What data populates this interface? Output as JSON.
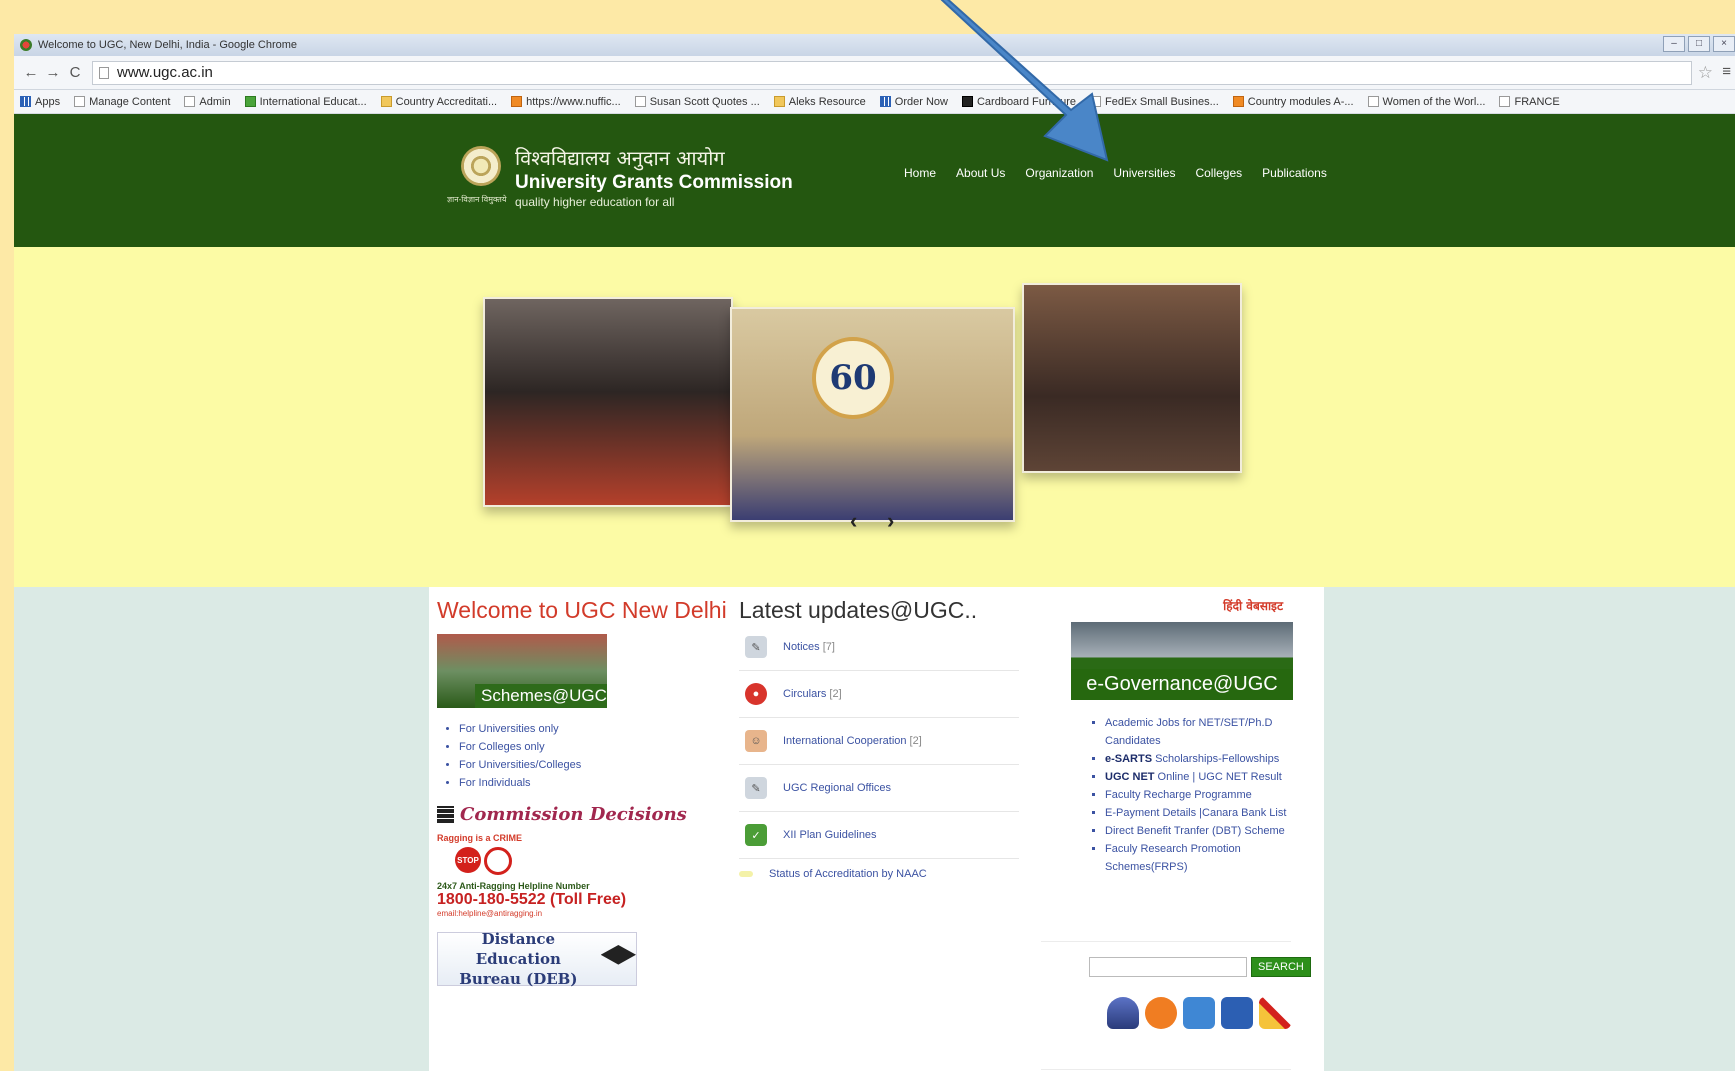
{
  "browser": {
    "window_title": "Welcome to UGC, New Delhi, India - Google Chrome",
    "url": "www.ugc.ac.in",
    "bookmarks": [
      {
        "label": "Apps",
        "icon": "apps-grid-icon"
      },
      {
        "label": "Manage Content",
        "icon": "page-icon"
      },
      {
        "label": "Admin",
        "icon": "page-icon"
      },
      {
        "label": "International Educat...",
        "icon": "plant-icon"
      },
      {
        "label": "Country Accreditati...",
        "icon": "folder-icon"
      },
      {
        "label": "https://www.nuffic...",
        "icon": "orange-icon"
      },
      {
        "label": "Susan Scott Quotes ...",
        "icon": "page-icon"
      },
      {
        "label": "Aleks Resource",
        "icon": "folder-icon"
      },
      {
        "label": "Order Now",
        "icon": "grid-icon"
      },
      {
        "label": "Cardboard Furniture",
        "icon": "black-icon"
      },
      {
        "label": "FedEx Small Busines...",
        "icon": "page-icon"
      },
      {
        "label": "Country modules A-...",
        "icon": "orange-icon"
      },
      {
        "label": "Women of the Worl...",
        "icon": "page-icon"
      },
      {
        "label": "FRANCE",
        "icon": "page-icon"
      }
    ]
  },
  "header": {
    "hindi_title": "विश्वविद्यालय अनुदान आयोग",
    "english_title": "University Grants Commission",
    "tagline": "quality higher education for all",
    "emblem_caption": "ज्ञान-विज्ञान विमुक्तये",
    "nav": [
      "Home",
      "About Us",
      "Organization",
      "Universities",
      "Colleges",
      "Publications"
    ]
  },
  "banner": {
    "badge_text": "60",
    "prev_label": "‹",
    "next_label": "›"
  },
  "left": {
    "welcome": "Welcome to UGC New Delhi",
    "schemes_label": "Schemes@UGC",
    "schemes": [
      "For Universities only",
      "For Colleges only",
      "For Universities/Colleges",
      "For Individuals"
    ],
    "decisions_label": "Commission Decisions",
    "ragging_title": "Ragging is a CRIME",
    "stop_text": "STOP",
    "helpline_label": "24x7 Anti-Ragging Helpline Number",
    "helpline_number": "1800-180-5522 (Toll Free)",
    "helpline_email": "email:helpline@antiragging.in",
    "deb_line1": "Distance Education",
    "deb_line2": "Bureau (DEB)"
  },
  "updates": {
    "title": "Latest updates@UGC..",
    "items": [
      {
        "label": "Notices",
        "count": "[7]"
      },
      {
        "label": "Circulars",
        "count": "[2]"
      },
      {
        "label": "International Cooperation",
        "count": "[2]"
      },
      {
        "label": "UGC Regional Offices",
        "count": ""
      },
      {
        "label": "XII Plan Guidelines",
        "count": ""
      },
      {
        "label": "Status of Accreditation by NAAC",
        "count": ""
      }
    ]
  },
  "right": {
    "hindi_site": "हिंदी वेबसाइट",
    "egov_label": "e-Governance@UGC",
    "links": [
      {
        "bold": "",
        "text": "Academic Jobs for NET/SET/Ph.D Candidates"
      },
      {
        "bold": "e-SARTS",
        "text": " Scholarships-Fellowships"
      },
      {
        "bold": "UGC NET",
        "text": " Online | UGC NET Result"
      },
      {
        "bold": "",
        "text": "Faculty Recharge Programme"
      },
      {
        "bold": "",
        "text": "E-Payment Details |Canara Bank List"
      },
      {
        "bold": "",
        "text": "Direct Benefit Tranfer (DBT) Scheme"
      },
      {
        "bold": "",
        "text": "Faculy Research Promotion Schemes(FRPS)"
      }
    ],
    "search_button": "SEARCH",
    "search_placeholder": ""
  },
  "colors": {
    "header_green": "#245710",
    "banner_yellow": "#fcfba5",
    "outer_yellow": "#fde9a6",
    "arrow_blue": "#4a86c8",
    "welcome_red": "#d23b2a"
  }
}
